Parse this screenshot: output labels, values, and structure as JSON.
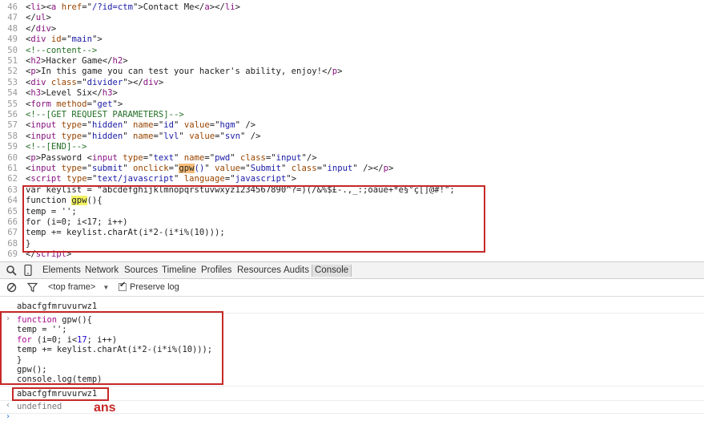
{
  "source": {
    "lines": [
      {
        "n": "46",
        "segs": [
          [
            "p",
            "<"
          ],
          [
            "t",
            "li"
          ],
          [
            "p",
            "><"
          ],
          [
            "t",
            "a"
          ],
          [
            "p",
            " "
          ],
          [
            "a",
            "href"
          ],
          [
            "p",
            "=\""
          ],
          [
            "v",
            "/?id=ctm"
          ],
          [
            "p",
            "\">Contact Me</"
          ],
          [
            "t",
            "a"
          ],
          [
            "p",
            "></"
          ],
          [
            "t",
            "li"
          ],
          [
            "p",
            ">"
          ]
        ]
      },
      {
        "n": "47",
        "segs": [
          [
            "p",
            "</"
          ],
          [
            "t",
            "ul"
          ],
          [
            "p",
            ">"
          ]
        ]
      },
      {
        "n": "48",
        "segs": [
          [
            "p",
            "</"
          ],
          [
            "t",
            "div"
          ],
          [
            "p",
            ">"
          ]
        ]
      },
      {
        "n": "49",
        "segs": [
          [
            "p",
            "<"
          ],
          [
            "t",
            "div"
          ],
          [
            "p",
            " "
          ],
          [
            "a",
            "id"
          ],
          [
            "p",
            "=\""
          ],
          [
            "v",
            "main"
          ],
          [
            "p",
            "\">"
          ]
        ]
      },
      {
        "n": "50",
        "segs": [
          [
            "c",
            "<!--content-->"
          ]
        ]
      },
      {
        "n": "51",
        "segs": [
          [
            "p",
            "<"
          ],
          [
            "t",
            "h2"
          ],
          [
            "p",
            ">Hacker Game</"
          ],
          [
            "t",
            "h2"
          ],
          [
            "p",
            ">"
          ]
        ]
      },
      {
        "n": "52",
        "segs": [
          [
            "p",
            "<"
          ],
          [
            "t",
            "p"
          ],
          [
            "p",
            ">In this game you can test your hacker's ability, enjoy!</"
          ],
          [
            "t",
            "p"
          ],
          [
            "p",
            ">"
          ]
        ]
      },
      {
        "n": "53",
        "segs": [
          [
            "p",
            "<"
          ],
          [
            "t",
            "div"
          ],
          [
            "p",
            " "
          ],
          [
            "a",
            "class"
          ],
          [
            "p",
            "=\""
          ],
          [
            "v",
            "divider"
          ],
          [
            "p",
            "\"></"
          ],
          [
            "t",
            "div"
          ],
          [
            "p",
            ">"
          ]
        ]
      },
      {
        "n": "54",
        "segs": [
          [
            "p",
            "<"
          ],
          [
            "t",
            "h3"
          ],
          [
            "p",
            ">Level Six</"
          ],
          [
            "t",
            "h3"
          ],
          [
            "p",
            ">"
          ]
        ]
      },
      {
        "n": "55",
        "segs": [
          [
            "p",
            "<"
          ],
          [
            "t",
            "form"
          ],
          [
            "p",
            " "
          ],
          [
            "a",
            "method"
          ],
          [
            "p",
            "=\""
          ],
          [
            "v",
            "get"
          ],
          [
            "p",
            "\">"
          ]
        ]
      },
      {
        "n": "56",
        "segs": [
          [
            "c",
            "<!--[GET REQUEST PARAMETERS]-->"
          ]
        ]
      },
      {
        "n": "57",
        "segs": [
          [
            "p",
            "<"
          ],
          [
            "t",
            "input"
          ],
          [
            "p",
            " "
          ],
          [
            "a",
            "type"
          ],
          [
            "p",
            "=\""
          ],
          [
            "v",
            "hidden"
          ],
          [
            "p",
            "\" "
          ],
          [
            "a",
            "name"
          ],
          [
            "p",
            "=\""
          ],
          [
            "v",
            "id"
          ],
          [
            "p",
            "\" "
          ],
          [
            "a",
            "value"
          ],
          [
            "p",
            "=\""
          ],
          [
            "v",
            "hgm"
          ],
          [
            "p",
            "\" />"
          ]
        ]
      },
      {
        "n": "58",
        "segs": [
          [
            "p",
            "<"
          ],
          [
            "t",
            "input"
          ],
          [
            "p",
            " "
          ],
          [
            "a",
            "type"
          ],
          [
            "p",
            "=\""
          ],
          [
            "v",
            "hidden"
          ],
          [
            "p",
            "\" "
          ],
          [
            "a",
            "name"
          ],
          [
            "p",
            "=\""
          ],
          [
            "v",
            "lvl"
          ],
          [
            "p",
            "\" "
          ],
          [
            "a",
            "value"
          ],
          [
            "p",
            "=\""
          ],
          [
            "v",
            "svn"
          ],
          [
            "p",
            "\" />"
          ]
        ]
      },
      {
        "n": "59",
        "segs": [
          [
            "c",
            "<!--[END]-->"
          ]
        ]
      },
      {
        "n": "60",
        "segs": [
          [
            "p",
            "<"
          ],
          [
            "t",
            "p"
          ],
          [
            "p",
            ">Password <"
          ],
          [
            "t",
            "input"
          ],
          [
            "p",
            " "
          ],
          [
            "a",
            "type"
          ],
          [
            "p",
            "=\""
          ],
          [
            "v",
            "text"
          ],
          [
            "p",
            "\" "
          ],
          [
            "a",
            "name"
          ],
          [
            "p",
            "=\""
          ],
          [
            "v",
            "pwd"
          ],
          [
            "p",
            "\" "
          ],
          [
            "a",
            "class"
          ],
          [
            "p",
            "=\""
          ],
          [
            "v",
            "input"
          ],
          [
            "p",
            "\"/>"
          ]
        ]
      },
      {
        "n": "61",
        "segs": [
          [
            "p",
            "<"
          ],
          [
            "t",
            "input"
          ],
          [
            "p",
            " "
          ],
          [
            "a",
            "type"
          ],
          [
            "p",
            "=\""
          ],
          [
            "v",
            "submit"
          ],
          [
            "p",
            "\" "
          ],
          [
            "a",
            "onclick"
          ],
          [
            "p",
            "=\""
          ],
          [
            "hl",
            "gpw"
          ],
          [
            "v",
            "()"
          ],
          [
            "p",
            "\" "
          ],
          [
            "a",
            "value"
          ],
          [
            "p",
            "=\""
          ],
          [
            "v",
            "Submit"
          ],
          [
            "p",
            "\" "
          ],
          [
            "a",
            "class"
          ],
          [
            "p",
            "=\""
          ],
          [
            "v",
            "input"
          ],
          [
            "p",
            "\" /></"
          ],
          [
            "t",
            "p"
          ],
          [
            "p",
            ">"
          ]
        ]
      },
      {
        "n": "62",
        "segs": [
          [
            "p",
            "<"
          ],
          [
            "t",
            "script"
          ],
          [
            "p",
            " "
          ],
          [
            "a",
            "type"
          ],
          [
            "p",
            "=\""
          ],
          [
            "v",
            "text/javascript"
          ],
          [
            "p",
            "\" "
          ],
          [
            "a",
            "language"
          ],
          [
            "p",
            "=\""
          ],
          [
            "v",
            "javascript"
          ],
          [
            "p",
            "\">"
          ]
        ]
      },
      {
        "n": "63",
        "segs": [
          [
            "p",
            "var keylist = \"abcdefghijklmnopqrstuvwxyz1234567890^?=)(/&%$£-.,_:;òàùè+*é§°ç[]@#!\";"
          ]
        ]
      },
      {
        "n": "64",
        "segs": [
          [
            "p",
            "function "
          ],
          [
            "hl2",
            "gpw"
          ],
          [
            "p",
            "(){"
          ]
        ]
      },
      {
        "n": "65",
        "segs": [
          [
            "p",
            "temp = '';"
          ]
        ]
      },
      {
        "n": "66",
        "segs": [
          [
            "p",
            "for (i=0; i<17; i++)"
          ]
        ]
      },
      {
        "n": "67",
        "segs": [
          [
            "p",
            "temp += keylist.charAt(i*2-(i*i%(10)));"
          ]
        ]
      },
      {
        "n": "68",
        "segs": [
          [
            "p",
            "}"
          ]
        ]
      },
      {
        "n": "69",
        "segs": [
          [
            "p",
            "</"
          ],
          [
            "t",
            "script"
          ],
          [
            "p",
            ">"
          ]
        ]
      }
    ]
  },
  "devtools": {
    "tabs": [
      {
        "label": "Elements",
        "key": "elements"
      },
      {
        "label": "Network",
        "key": "network"
      },
      {
        "label": "Sources",
        "key": "sources"
      },
      {
        "label": "Timeline",
        "key": "timeline"
      },
      {
        "label": "Profiles",
        "key": "profiles"
      },
      {
        "label": "Resources",
        "key": "resources"
      },
      {
        "label": "Audits",
        "key": "audits"
      },
      {
        "label": "Console",
        "key": "console"
      }
    ],
    "active_tab": "Console",
    "frame_select": "<top frame>",
    "preserve_log_label": "Preserve log",
    "preserve_log_checked": true
  },
  "console": {
    "output_first": "abacfgfmruvurwz1",
    "input_code": [
      {
        "segs": [
          [
            "kw",
            "function"
          ],
          [
            "p",
            " gpw(){"
          ]
        ]
      },
      {
        "segs": [
          [
            "p",
            "temp = '';"
          ]
        ]
      },
      {
        "segs": [
          [
            "kw",
            "for"
          ],
          [
            "p",
            " (i=0; i<"
          ],
          [
            "num",
            "17"
          ],
          [
            "p",
            "; i++)"
          ]
        ]
      },
      {
        "segs": [
          [
            "p",
            "temp += keylist.charAt(i*2-(i*i%(10)));"
          ]
        ]
      },
      {
        "segs": [
          [
            "p",
            "}"
          ]
        ]
      },
      {
        "segs": [
          [
            "p",
            "gpw();"
          ]
        ]
      },
      {
        "segs": [
          [
            "p",
            "console.log(temp)"
          ]
        ]
      }
    ],
    "output_result": "abacfgfmruvurwz1",
    "return_value": "undefined",
    "annotation": "ans",
    "accent_color": "#c62828"
  }
}
